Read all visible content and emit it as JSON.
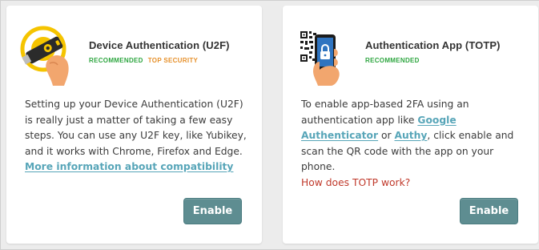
{
  "cards": [
    {
      "title": "Device Authentication (U2F)",
      "badges": [
        "RECOMMENDED",
        "TOP SECURITY"
      ],
      "icon": "usb-security-key-icon",
      "description": "Setting up your Device Authentication (U2F) is really just a matter of taking a few easy steps. You can use any U2F key, like Yubikey, and it works with Chrome, Firefox and Edge.",
      "link": "More information about compatibility",
      "button": "Enable"
    },
    {
      "title": "Authentication App (TOTP)",
      "badges": [
        "RECOMMENDED"
      ],
      "icon": "phone-qr-lock-icon",
      "description_pre": "To enable app-based 2FA using an authentication app like ",
      "link1": "Google Authenticator",
      "description_mid": " or ",
      "link2": "Authy",
      "description_post": ", click enable and scan the QR code with the app on your phone.",
      "help_link": "How does TOTP work?",
      "button": "Enable"
    }
  ],
  "colors": {
    "green_badge": "#2ea640",
    "orange_badge": "#e6902a",
    "link": "#57a5b8",
    "help_link": "#c0392b",
    "button": "#5e8d91"
  }
}
